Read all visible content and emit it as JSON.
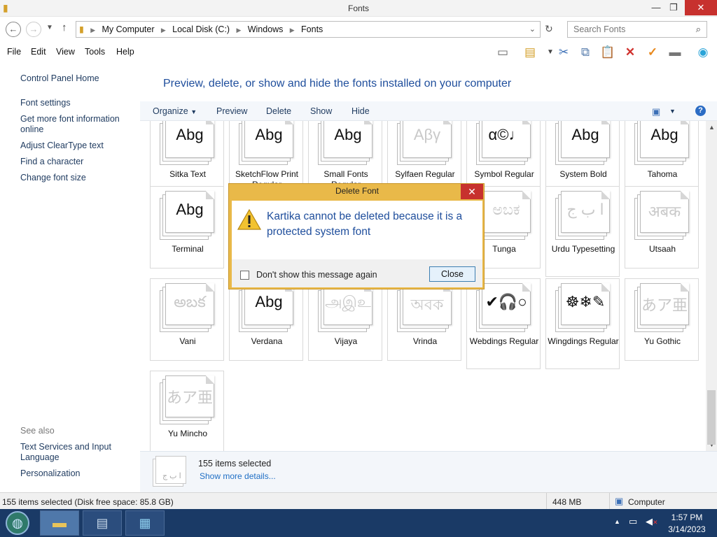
{
  "window": {
    "title": "Fonts",
    "minimize": "—",
    "maximize": "❐",
    "close": "✕"
  },
  "address": {
    "crumbs": [
      "My Computer",
      "Local Disk (C:)",
      "Windows",
      "Fonts"
    ],
    "search_placeholder": "Search Fonts"
  },
  "menu": [
    "File",
    "Edit",
    "View",
    "Tools",
    "Help"
  ],
  "left_pane": {
    "home": "Control Panel Home",
    "links": [
      "Font settings",
      "Get more font information online",
      "Adjust ClearType text",
      "Find a character",
      "Change font size"
    ],
    "see_also_label": "See also",
    "see_also": [
      "Text Services and Input Language",
      "Personalization"
    ]
  },
  "main": {
    "heading": "Preview, delete, or show and hide the fonts installed on your computer",
    "commands": [
      "Organize",
      "Preview",
      "Delete",
      "Show",
      "Hide"
    ]
  },
  "fonts": [
    {
      "name": "Sitka Text",
      "glyph": "Abg",
      "faded": false
    },
    {
      "name": "SketchFlow Print Regular",
      "glyph": "Abg",
      "faded": false
    },
    {
      "name": "Small Fonts Regular",
      "glyph": "Abg",
      "faded": false
    },
    {
      "name": "Sylfaen Regular",
      "glyph": "Αβγ",
      "faded": true
    },
    {
      "name": "Symbol Regular",
      "glyph": "α©♩",
      "faded": false
    },
    {
      "name": "System Bold",
      "glyph": "Abg",
      "faded": false
    },
    {
      "name": "Tahoma",
      "glyph": "Abg",
      "faded": false
    },
    {
      "name": "Terminal",
      "glyph": "Abg",
      "faded": false
    },
    {
      "name": "",
      "glyph": "",
      "faded": true
    },
    {
      "name": "",
      "glyph": "",
      "faded": true
    },
    {
      "name": "",
      "glyph": "",
      "faded": true
    },
    {
      "name": "Tunga",
      "glyph": "ಅಬಕ",
      "faded": true
    },
    {
      "name": "Urdu Typesetting",
      "glyph": "ا ب ج",
      "faded": true
    },
    {
      "name": "Utsaah",
      "glyph": "अबक",
      "faded": true
    },
    {
      "name": "Vani",
      "glyph": "అబక",
      "faded": true
    },
    {
      "name": "Verdana",
      "glyph": "Abg",
      "faded": false
    },
    {
      "name": "Vijaya",
      "glyph": "அஇஉ",
      "faded": true
    },
    {
      "name": "Vrinda",
      "glyph": "অবক",
      "faded": true
    },
    {
      "name": "Webdings Regular",
      "glyph": "✔🎧○",
      "faded": false
    },
    {
      "name": "Wingdings Regular",
      "glyph": "☸❄✎",
      "faded": false
    },
    {
      "name": "Yu Gothic",
      "glyph": "あア亜",
      "faded": true
    },
    {
      "name": "Yu Mincho",
      "glyph": "あア亜",
      "faded": true
    }
  ],
  "details": {
    "count": "155 items selected",
    "more": "Show more details..."
  },
  "statusbar": {
    "left": "155 items selected (Disk free space: 85.8 GB)",
    "size": "448 MB",
    "location": "Computer"
  },
  "dialog": {
    "title": "Delete Font",
    "close_glyph": "✕",
    "message": "Kartika cannot be deleted because it is a protected system font",
    "checkbox_label": "Don't show this message again",
    "button": "Close"
  },
  "tray": {
    "time": "1:57 PM",
    "date": "3/14/2023"
  }
}
